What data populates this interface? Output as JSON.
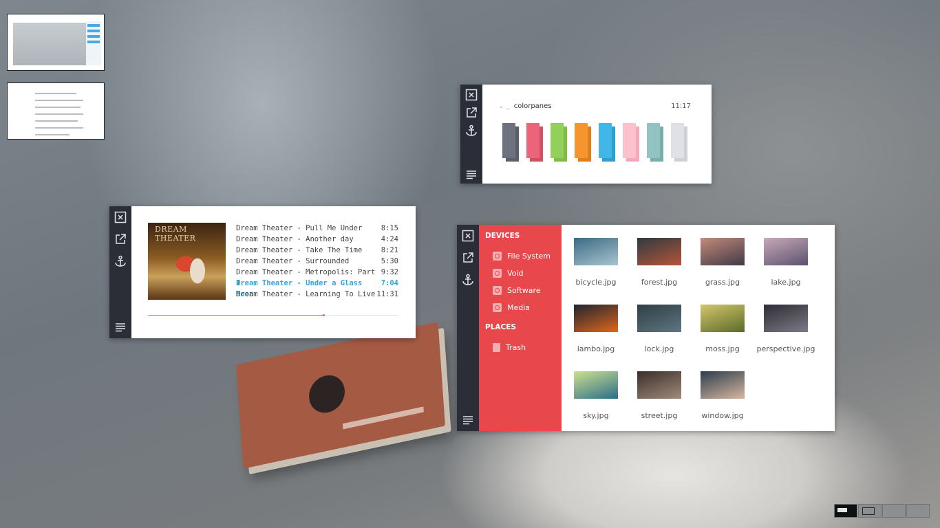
{
  "colorpanes": {
    "title": "colorpanes",
    "prefix": "_",
    "time": "11:17",
    "swatches": [
      {
        "front": "#6d727e",
        "back": "#5a5f6a"
      },
      {
        "front": "#ea6579",
        "back": "#d44e62"
      },
      {
        "front": "#93cf5b",
        "back": "#7fbd47"
      },
      {
        "front": "#f5952e",
        "back": "#e07f18"
      },
      {
        "front": "#42b7e5",
        "back": "#2c9fcd"
      },
      {
        "front": "#fbc2cc",
        "back": "#f3aab6"
      },
      {
        "front": "#92c2c1",
        "back": "#79adac"
      },
      {
        "front": "#dfe1e6",
        "back": "#cdd0d6"
      }
    ]
  },
  "music": {
    "album_title": "DREAM THEATER",
    "tracks": [
      {
        "name": "Dream Theater - Pull Me Under",
        "duration": "8:15"
      },
      {
        "name": "Dream Theater - Another day",
        "duration": "4:24"
      },
      {
        "name": "Dream Theater - Take The Time",
        "duration": "8:21"
      },
      {
        "name": "Dream Theater - Surrounded",
        "duration": "5:30"
      },
      {
        "name": "Dream Theater - Metropolis: Part I",
        "duration": "9:32"
      },
      {
        "name": "Dream Theater - Under a Glass Moon",
        "duration": "7:04",
        "active": true
      },
      {
        "name": "Dream Theater - Learning To Live",
        "duration": "11:31"
      }
    ],
    "progress": 0.7,
    "accent": "#2ba7e3"
  },
  "filemanager": {
    "devices_heading": "DEVICES",
    "devices": [
      "File System",
      "Void",
      "Software",
      "Media"
    ],
    "places_heading": "PLACES",
    "places": [
      "Trash"
    ],
    "accent": "#e8474c",
    "files": [
      {
        "name": "bicycle.jpg",
        "c1": "#3b6b84",
        "c2": "#a9c3cf"
      },
      {
        "name": "forest.jpg",
        "c1": "#2f3a3f",
        "c2": "#b5553a"
      },
      {
        "name": "grass.jpg",
        "c1": "#c58a7a",
        "c2": "#3f3a46"
      },
      {
        "name": "lake.jpg",
        "c1": "#c9a9b7",
        "c2": "#5a5270"
      },
      {
        "name": "lambo.jpg",
        "c1": "#1e2430",
        "c2": "#e0661c"
      },
      {
        "name": "lock.jpg",
        "c1": "#2e3e45",
        "c2": "#5e7680"
      },
      {
        "name": "moss.jpg",
        "c1": "#d2c66a",
        "c2": "#5c6b2a"
      },
      {
        "name": "perspective.jpg",
        "c1": "#2d2d36",
        "c2": "#7c7a84"
      },
      {
        "name": "sky.jpg",
        "c1": "#cfe08e",
        "c2": "#2a6e8a"
      },
      {
        "name": "street.jpg",
        "c1": "#3a2f2b",
        "c2": "#a08a78"
      },
      {
        "name": "window.jpg",
        "c1": "#2c3d4d",
        "c2": "#d7b6a0"
      }
    ]
  },
  "workspaces": {
    "count": 4,
    "active": 0
  }
}
